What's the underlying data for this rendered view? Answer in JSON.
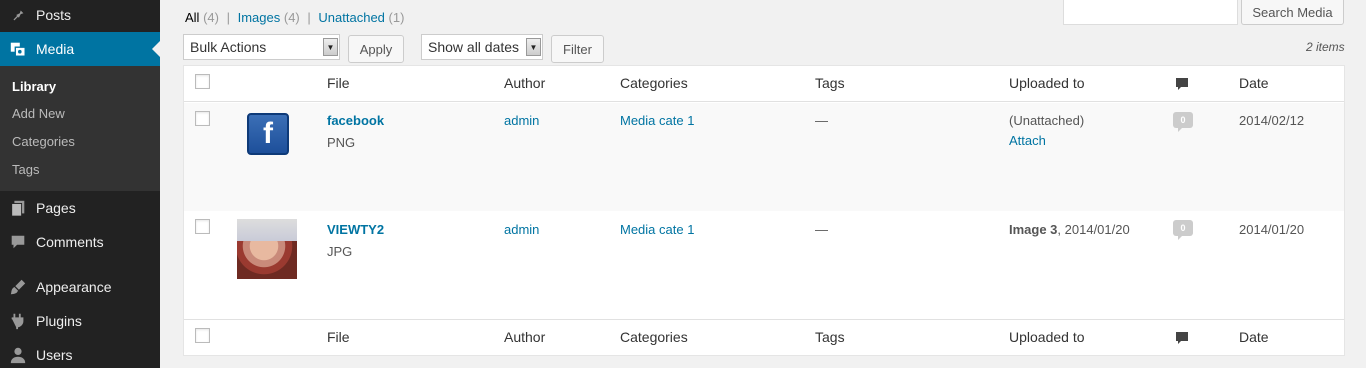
{
  "sidebar": {
    "menu": [
      {
        "label": "Posts",
        "icon": "pin-icon"
      },
      {
        "label": "Media",
        "icon": "media-icon"
      },
      {
        "label": "Pages",
        "icon": "pages-icon"
      },
      {
        "label": "Comments",
        "icon": "comments-icon"
      },
      {
        "label": "Appearance",
        "icon": "brush-icon"
      },
      {
        "label": "Plugins",
        "icon": "plug-icon"
      },
      {
        "label": "Users",
        "icon": "user-icon"
      }
    ],
    "submenu": [
      "Library",
      "Add New",
      "Categories",
      "Tags"
    ]
  },
  "views": {
    "all": {
      "label": "All",
      "count": "(4)"
    },
    "images": {
      "label": "Images",
      "count": "(4)"
    },
    "unattached": {
      "label": "Unattached",
      "count": "(1)"
    },
    "separator": "|"
  },
  "search": {
    "placeholder": "",
    "button": "Search Media"
  },
  "filters": {
    "bulk_actions": "Bulk Actions",
    "apply": "Apply",
    "dates": "Show all dates",
    "filter": "Filter",
    "items_count": "2 items"
  },
  "table": {
    "columns": {
      "file": "File",
      "author": "Author",
      "categories": "Categories",
      "tags": "Tags",
      "uploaded_to": "Uploaded to",
      "date": "Date"
    },
    "rows": [
      {
        "title": "facebook",
        "type": "PNG",
        "author": "admin",
        "categories": "Media cate 1",
        "tags": "—",
        "uploaded_to": "(Unattached)",
        "attach": "Attach",
        "comments": "0",
        "date": "2014/02/12"
      },
      {
        "title": "VIEWTY2",
        "type": "JPG",
        "author": "admin",
        "categories": "Media cate 1",
        "tags": "—",
        "uploaded_to_title": "Image 3",
        "uploaded_to_date": ", 2014/01/20",
        "comments": "0",
        "date": "2014/01/20"
      }
    ]
  },
  "colors": {
    "sidebar_bg": "#222222",
    "accent": "#0074a2",
    "page_bg": "#f1f1f1"
  }
}
